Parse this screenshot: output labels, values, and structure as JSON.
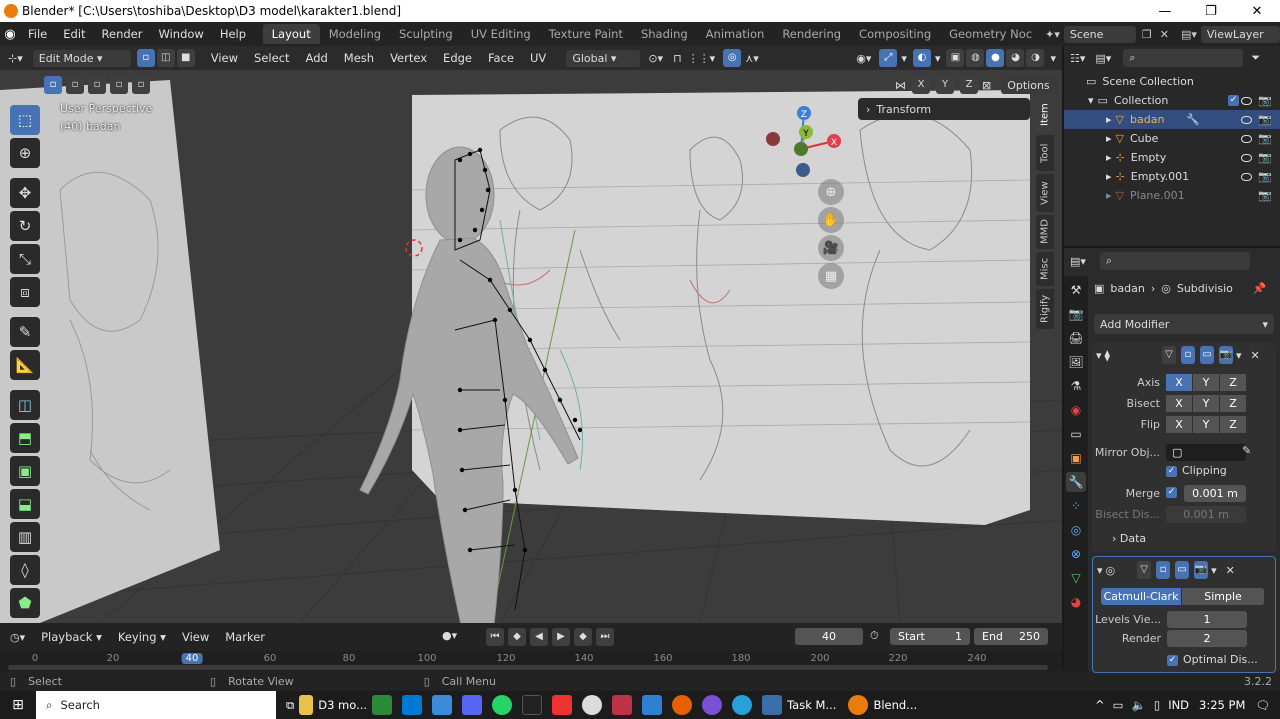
{
  "window": {
    "title": "Blender* [C:\\Users\\toshiba\\Desktop\\D3 model\\karakter1.blend]",
    "min": "—",
    "max": "❐",
    "close": "✕"
  },
  "menu": {
    "items": [
      "File",
      "Edit",
      "Render",
      "Window",
      "Help"
    ],
    "workspaces": [
      "Layout",
      "Modeling",
      "Sculpting",
      "UV Editing",
      "Texture Paint",
      "Shading",
      "Animation",
      "Rendering",
      "Compositing",
      "Geometry Noc"
    ],
    "scene": "Scene",
    "view_layer": "ViewLayer"
  },
  "header": {
    "mode": "Edit Mode",
    "menus": [
      "View",
      "Select",
      "Add",
      "Mesh",
      "Vertex",
      "Edge",
      "Face",
      "UV"
    ],
    "orientation": "Global",
    "options": "Options",
    "axes": [
      "X",
      "Y",
      "Z"
    ]
  },
  "viewport": {
    "perspective": "User Perspective",
    "object_info": "(40) badan",
    "transform_panel": "Transform",
    "side_tabs": [
      "Item",
      "Tool",
      "View",
      "MMD",
      "Misc",
      "Rigify"
    ],
    "gizmo": {
      "x": "X",
      "y": "Y",
      "z": "Z"
    }
  },
  "timeline": {
    "menus": [
      "Playback",
      "Keying",
      "View",
      "Marker"
    ],
    "current_frame": "40",
    "start_label": "Start",
    "start": "1",
    "end_label": "End",
    "end": "250",
    "ticks": [
      "0",
      "20",
      "40",
      "60",
      "80",
      "100",
      "120",
      "140",
      "160",
      "180",
      "200",
      "220",
      "240"
    ]
  },
  "status": {
    "select": "Select",
    "rotate": "Rotate View",
    "call_menu": "Call Menu",
    "version": "3.2.2"
  },
  "outliner": {
    "root": "Scene Collection",
    "collection": "Collection",
    "items": [
      {
        "name": "badan",
        "selected": true
      },
      {
        "name": "Cube",
        "selected": false
      },
      {
        "name": "Empty",
        "selected": false
      },
      {
        "name": "Empty.001",
        "selected": false
      },
      {
        "name": "Plane.001",
        "selected": false
      }
    ]
  },
  "properties": {
    "breadcrumb_object": "badan",
    "breadcrumb_modifier": "Subdivisio",
    "add_modifier": "Add Modifier",
    "mirror": {
      "axis_label": "Axis",
      "bisect_label": "Bisect",
      "flip_label": "Flip",
      "mirror_obj_label": "Mirror Obj...",
      "clipping_label": "Clipping",
      "merge_label": "Merge",
      "merge_value": "0.001 m",
      "bisect_dist_label": "Bisect Dis...",
      "bisect_dist_value": "0.001 m",
      "data_label": "Data"
    },
    "subsurf": {
      "catmull": "Catmull-Clark",
      "simple": "Simple",
      "levels_label": "Levels Vie...",
      "levels_value": "1",
      "render_label": "Render",
      "render_value": "2",
      "optimal_label": "Optimal Dis..."
    }
  },
  "taskbar": {
    "search": "Search",
    "apps": [
      "D3 mo...",
      "Task M...",
      "Blend..."
    ],
    "lang": "IND",
    "time": "3:25 PM"
  },
  "colors": {
    "accent": "#4772b3",
    "selected_row": "#334d80",
    "orange": "#e87d0d"
  }
}
